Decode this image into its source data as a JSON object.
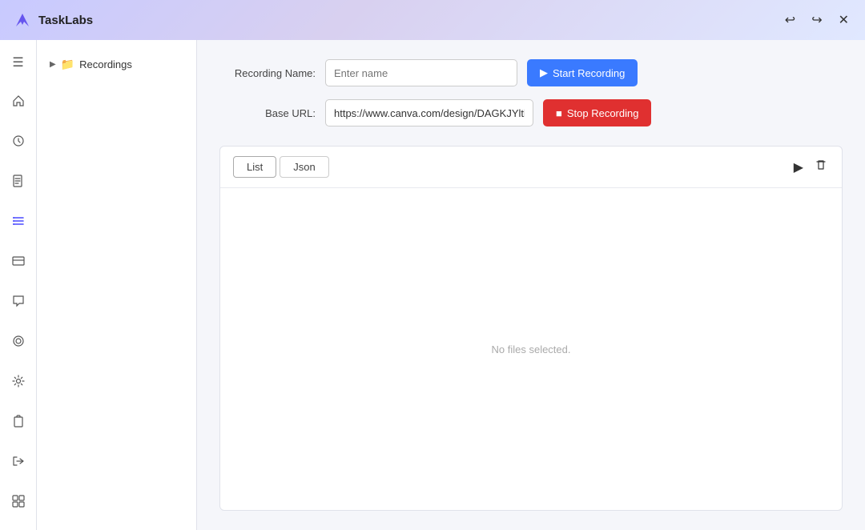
{
  "titleBar": {
    "appName": "TaskLabs",
    "controls": {
      "back": "←",
      "forward": "→",
      "close": "✕"
    }
  },
  "sidebarIcons": [
    {
      "name": "menu-icon",
      "symbol": "☰"
    },
    {
      "name": "home-icon",
      "symbol": "⌂"
    },
    {
      "name": "clock-icon",
      "symbol": "◷"
    },
    {
      "name": "document-icon",
      "symbol": "📄"
    },
    {
      "name": "list-icon",
      "symbol": "☰"
    },
    {
      "name": "card-icon",
      "symbol": "▤"
    },
    {
      "name": "chat-icon",
      "symbol": "💬"
    },
    {
      "name": "record-icon",
      "symbol": "⊙"
    },
    {
      "name": "settings-icon",
      "symbol": "⚙"
    },
    {
      "name": "clipboard-icon",
      "symbol": "📋"
    },
    {
      "name": "login-icon",
      "symbol": "→|"
    },
    {
      "name": "grid-icon",
      "symbol": "⊞"
    }
  ],
  "sideNav": {
    "items": [
      {
        "label": "Recordings",
        "icon": "📁",
        "chevron": "▶"
      }
    ]
  },
  "form": {
    "recordingNameLabel": "Recording Name:",
    "recordingNamePlaceholder": "Enter name",
    "baseUrlLabel": "Base URL:",
    "baseUrlValue": "https://www.canva.com/design/DAGKJYltbXU/hvWLs.",
    "startRecordingLabel": "Start Recording",
    "stopRecordingLabel": "Stop Recording"
  },
  "panel": {
    "tabs": [
      {
        "label": "List",
        "active": true
      },
      {
        "label": "Json",
        "active": false
      }
    ],
    "playIcon": "▶",
    "deleteIcon": "🗑",
    "emptyText": "No files selected."
  }
}
